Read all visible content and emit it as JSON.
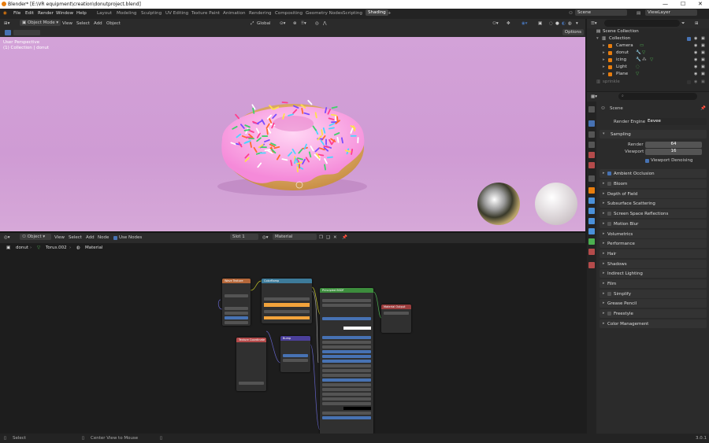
{
  "window": {
    "title": "Blender* [E:\\VR equipment\\creation\\donutproject.blend]",
    "controls": [
      "—",
      "☐",
      "✕"
    ]
  },
  "menu": {
    "items": [
      "File",
      "Edit",
      "Render",
      "Window",
      "Help"
    ],
    "workspaces": [
      "Layout",
      "Modeling",
      "Sculpting",
      "UV Editing",
      "Texture Paint",
      "Animation",
      "Rendering",
      "Compositing",
      "Geometry Nodes",
      "Scripting",
      "Shading"
    ],
    "active_workspace": "Shading",
    "add_tab": "+",
    "scene": "Scene",
    "view_layer": "ViewLayer"
  },
  "viewport": {
    "mode": "Object Mode",
    "menus": [
      "View",
      "Select",
      "Add",
      "Object"
    ],
    "orientation": "Global",
    "options_label": "Options",
    "overlay_line1": "User Perspective",
    "overlay_line2": "(1) Collection | donut"
  },
  "node_editor": {
    "editor_type": "Object",
    "menus": [
      "View",
      "Select",
      "Add",
      "Node"
    ],
    "use_nodes_label": "Use Nodes",
    "slot": "Slot 1",
    "material": "Material",
    "breadcrumb": [
      "donut",
      "Torus.002",
      "Material"
    ],
    "nodes": {
      "wave": "Wave Texture",
      "ramp": "ColorRamp",
      "coord": "Texture Coordinate",
      "bump": "Bump",
      "bsdf": "Principled BSDF",
      "output": "Material Output"
    }
  },
  "statusbar": {
    "select": "Select",
    "center_view": "Center View to Mouse",
    "version": "3.0.1"
  },
  "outliner": {
    "root": "Scene Collection",
    "collection": "Collection",
    "items": [
      "Camera",
      "donut",
      "icing",
      "Light",
      "Plane"
    ],
    "excluded": "sprinkle"
  },
  "properties": {
    "context": "Scene",
    "render_engine_label": "Render Engine",
    "render_engine": "Eevee",
    "sampling_label": "Sampling",
    "render_label": "Render",
    "render_samples": "64",
    "viewport_label": "Viewport",
    "viewport_samples": "16",
    "denoise_label": "Viewport Denoising",
    "panels": [
      "Ambient Occlusion",
      "Bloom",
      "Depth of Field",
      "Subsurface Scattering",
      "Screen Space Reflections",
      "Motion Blur",
      "Volumetrics",
      "Performance",
      "Hair",
      "Shadows",
      "Indirect Lighting",
      "Film",
      "Simplify",
      "Grease Pencil",
      "Freestyle",
      "Color Management"
    ]
  },
  "colors": {
    "accent": "#4772b3",
    "viewport_bg": "#d3a2d8",
    "blender_orange": "#e87d0d"
  }
}
